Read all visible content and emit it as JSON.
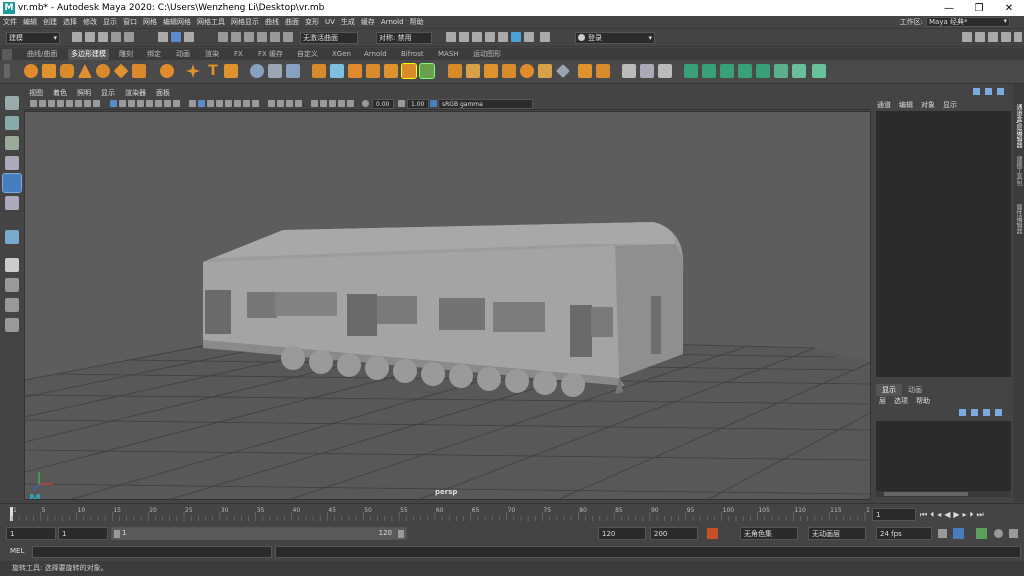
{
  "window": {
    "title": "vr.mb* - Autodesk Maya 2020: C:\\Users\\Wenzheng Li\\Desktop\\vr.mb",
    "logo": "M",
    "minimize": "—",
    "maximize": "❐",
    "close": "✕"
  },
  "menubar": {
    "items": [
      "文件",
      "编辑",
      "创建",
      "选择",
      "修改",
      "显示",
      "窗口",
      "网格",
      "编辑网格",
      "网格工具",
      "网格显示",
      "曲线",
      "曲面",
      "变形",
      "UV",
      "生成",
      "缓存",
      "Arnold",
      "帮助"
    ],
    "workspace_label": "工作区:",
    "workspace_value": "Maya 经典*"
  },
  "statusline": {
    "mode": "建模",
    "live_surface": "无激活曲面",
    "symmetry": "对称: 禁用",
    "login": "登录"
  },
  "shelf": {
    "tabs": [
      "曲线/曲面",
      "多边形建模",
      "雕刻",
      "绑定",
      "动画",
      "渲染",
      "FX",
      "FX 缓存",
      "自定义",
      "XGen",
      "Arnold",
      "Bifrost",
      "MASH",
      "运动图形"
    ],
    "active_tab": "多边形建模"
  },
  "viewport": {
    "menu": [
      "视图",
      "着色",
      "照明",
      "显示",
      "渲染器",
      "面板"
    ],
    "exposure": "0.00",
    "gamma": "1.00",
    "color_space": "sRGB gamma",
    "camera_label": "persp"
  },
  "channelbox": {
    "menu": [
      "通道",
      "编辑",
      "对象",
      "显示"
    ]
  },
  "layers": {
    "tabs": [
      "显示",
      "动画"
    ],
    "menu": [
      "层",
      "选项",
      "帮助"
    ]
  },
  "sidetabs": [
    "通道盒/层编辑器",
    "建模工具包",
    "属性编辑器"
  ],
  "timeline": {
    "ticks": [
      "1",
      "5",
      "10",
      "15",
      "20",
      "25",
      "30",
      "35",
      "40",
      "45",
      "50",
      "55",
      "60",
      "65",
      "70",
      "75",
      "80",
      "85",
      "90",
      "95",
      "100",
      "105",
      "110",
      "115",
      "120"
    ],
    "current_frame": "1"
  },
  "range": {
    "start": "1",
    "playback_start": "1",
    "slider_start": "1",
    "slider_end": "120",
    "playback_end": "120",
    "end": "200",
    "character_set": "无角色集",
    "anim_layer": "无动画层",
    "fps": "24 fps"
  },
  "mel": {
    "label": "MEL"
  },
  "helpline": {
    "text": "旋转工具: 选择要旋转的对象。"
  }
}
